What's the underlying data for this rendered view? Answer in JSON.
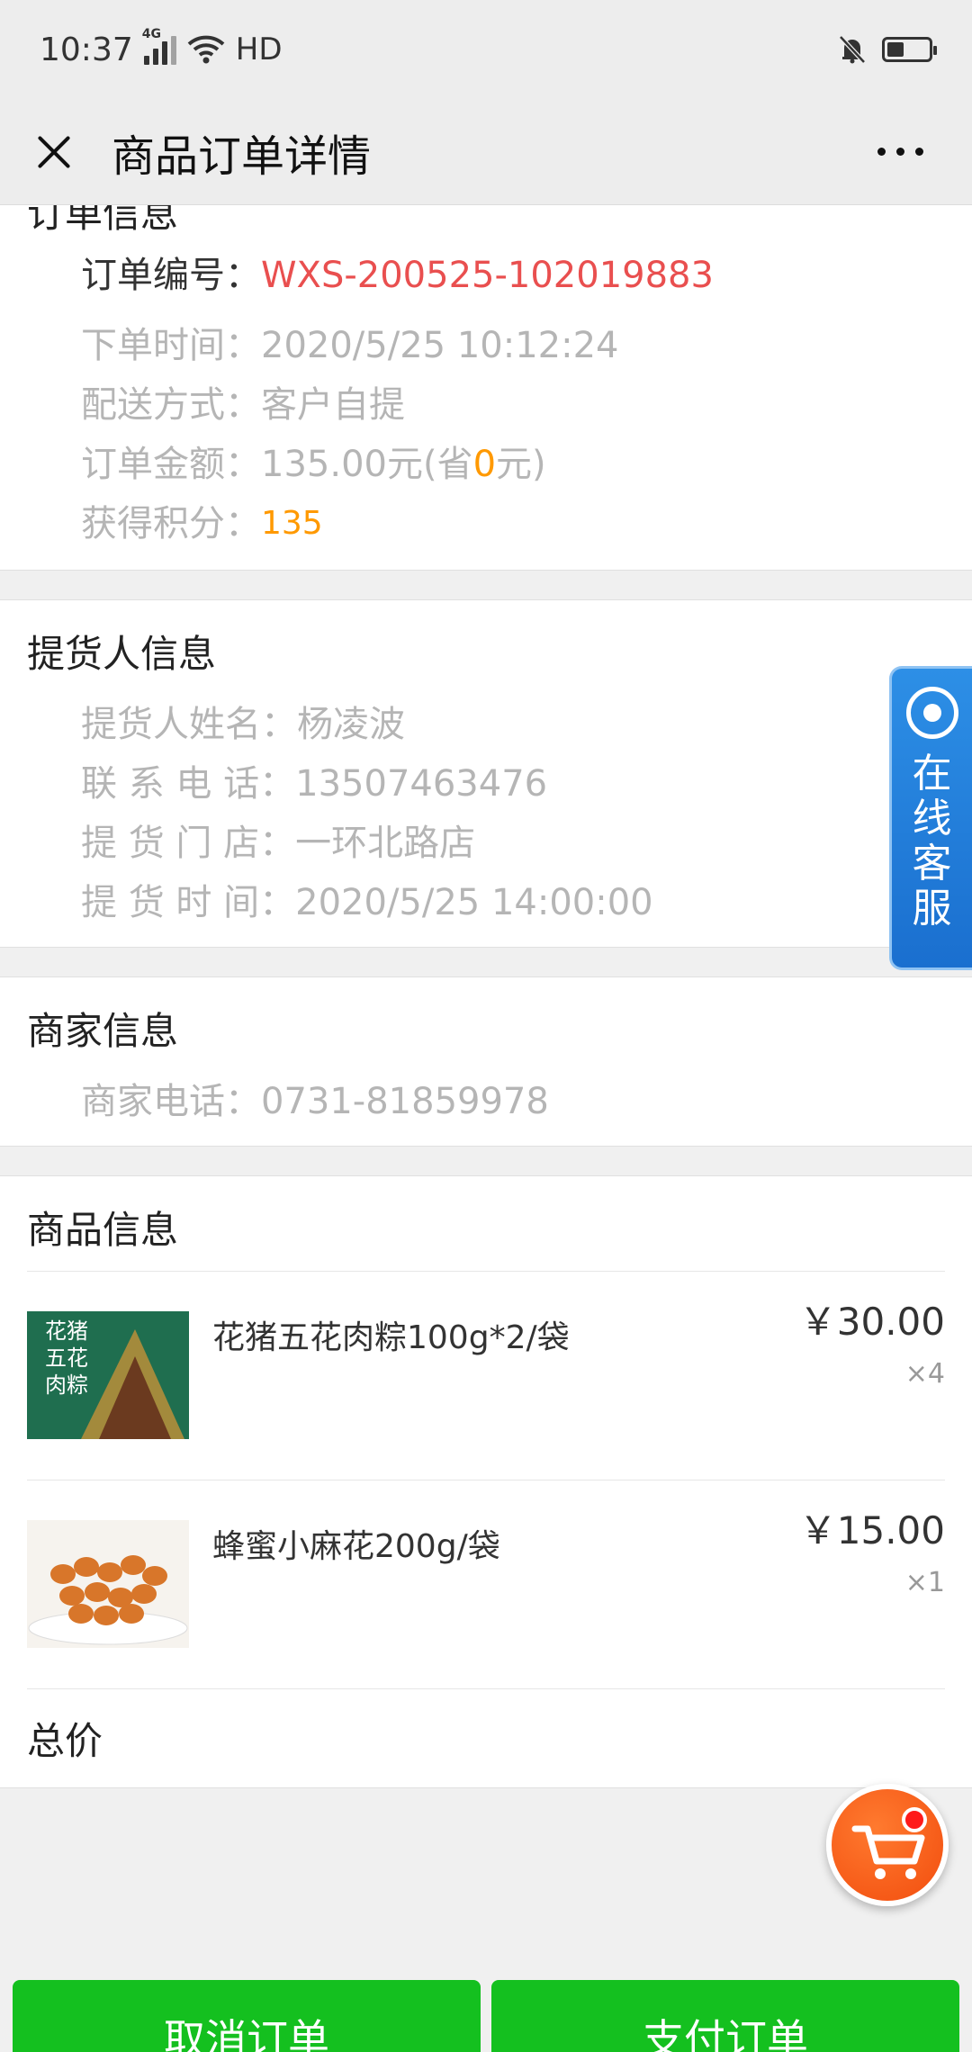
{
  "status_bar": {
    "time": "10:37",
    "network": "4G",
    "wifi_label": "HD"
  },
  "header": {
    "title": "商品订单详情"
  },
  "order_info": {
    "title": "订单信息",
    "order_no_label": "订单编号：",
    "order_no": "WXS-200525-102019883",
    "time_label": "下单时间：",
    "time": "2020/5/25 10:12:24",
    "delivery_label": "配送方式：",
    "delivery": "客户自提",
    "amount_label": "订单金额：",
    "amount_prefix": "135.00元(省",
    "amount_saved": "0",
    "amount_suffix": "元)",
    "points_label": "获得积分：",
    "points": "135"
  },
  "pickup_info": {
    "title": "提货人信息",
    "name_label": "提货人姓名：",
    "name": "杨凌波",
    "phone_label": "联 系 电 话：",
    "phone": "13507463476",
    "store_label": "提 货 门 店：",
    "store": "一环北路店",
    "pickup_time_label": "提 货 时 间：",
    "pickup_time": "2020/5/25 14:00:00"
  },
  "merchant_info": {
    "title": "商家信息",
    "phone_label": "商家电话：",
    "phone": "0731-81859978"
  },
  "products": {
    "title": "商品信息",
    "items": [
      {
        "name": "花猪五花肉粽100g*2/袋",
        "price": "￥30.00",
        "qty": "×4",
        "thumb_text_1": "花猪",
        "thumb_text_2": "五花",
        "thumb_text_3": "肉粽"
      },
      {
        "name": "蜂蜜小麻花200g/袋",
        "price": "￥15.00",
        "qty": "×1"
      }
    ],
    "total_label": "总价"
  },
  "customer_service": {
    "label": "在线客服"
  },
  "actions": {
    "cancel": "取消订单",
    "pay": "支付订单"
  },
  "colors": {
    "accent_red": "#e94f4f",
    "accent_orange": "#ff9900",
    "button_green": "#14c01f",
    "cs_blue": "#1a6fcf"
  }
}
